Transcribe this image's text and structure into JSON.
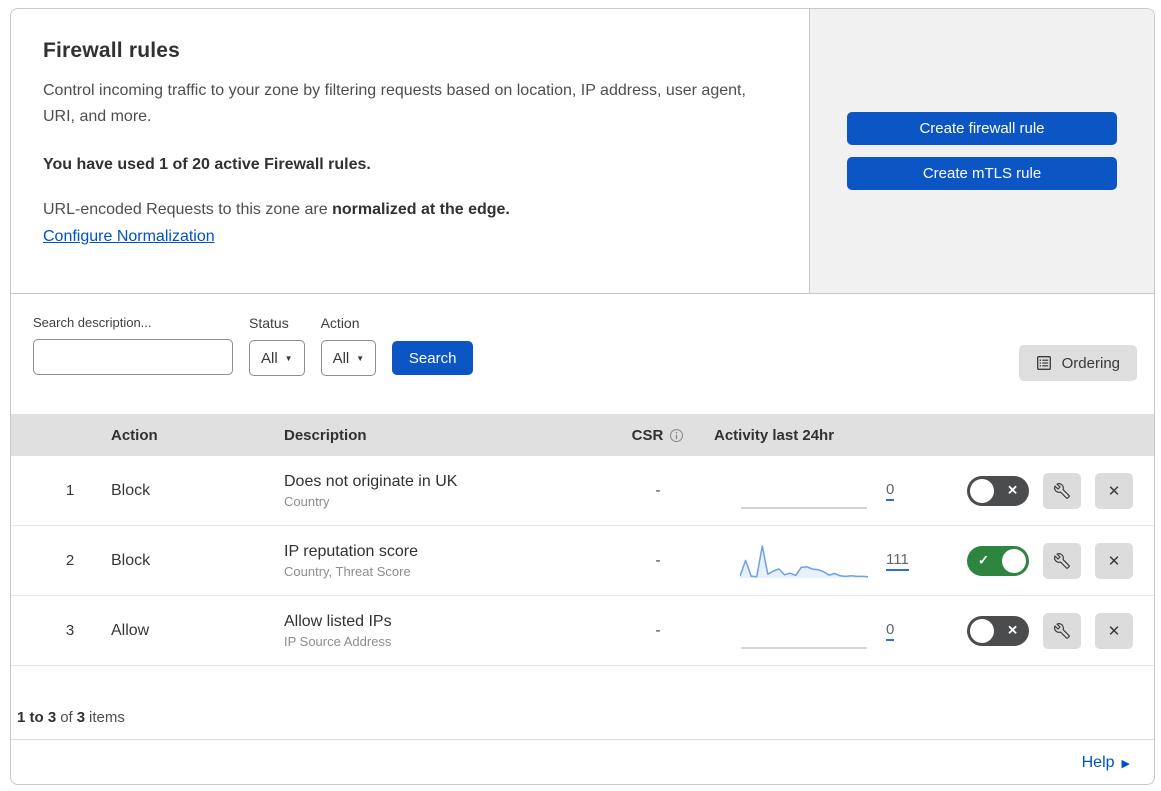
{
  "header": {
    "title": "Firewall rules",
    "description": "Control incoming traffic to your zone by filtering requests based on location, IP address, user agent, URI, and more.",
    "usage_text": "You have used 1 of 20 active Firewall rules.",
    "normalization_text": "URL-encoded Requests to this zone are ",
    "normalization_bold": "normalized at the edge.",
    "normalization_link": "Configure Normalization",
    "create_firewall_button": "Create firewall rule",
    "create_mtls_button": "Create mTLS rule"
  },
  "filters": {
    "search_label": "Search description...",
    "search_value": "",
    "status_label": "Status",
    "status_value": "All",
    "action_label": "Action",
    "action_value": "All",
    "search_button": "Search",
    "ordering_button": "Ordering"
  },
  "table": {
    "columns": {
      "action": "Action",
      "description": "Description",
      "csr": "CSR",
      "activity": "Activity last 24hr"
    },
    "rows": [
      {
        "priority": "1",
        "action": "Block",
        "description": "Does not originate in UK",
        "fields": "Country",
        "csr": "-",
        "activity_count": "0",
        "activity_sparkline": null,
        "enabled": false
      },
      {
        "priority": "2",
        "action": "Block",
        "description": "IP reputation score",
        "fields": "Country, Threat Score",
        "csr": "-",
        "activity_count": "111",
        "activity_sparkline": [
          6,
          55,
          6,
          4,
          100,
          12,
          22,
          28,
          10,
          15,
          8,
          33,
          35,
          28,
          26,
          20,
          9,
          14,
          7,
          5,
          7,
          5,
          5,
          4
        ],
        "enabled": true
      },
      {
        "priority": "3",
        "action": "Allow",
        "description": "Allow listed IPs",
        "fields": "IP Source Address",
        "csr": "-",
        "activity_count": "0",
        "activity_sparkline": null,
        "enabled": false
      }
    ]
  },
  "footer": {
    "range": "1 to 3",
    "of": "of",
    "total": "3",
    "items": "items",
    "help": "Help"
  },
  "colors": {
    "accent_blue": "#0b55c4",
    "link_blue": "#0051c3",
    "toggle_on_green": "#2e8540",
    "toggle_off_gray": "#4a4c4e",
    "sparkline_blue": "#6e9fe8",
    "table_header_bg": "#e0e0e0",
    "panel_bg": "#f1f1f1"
  }
}
